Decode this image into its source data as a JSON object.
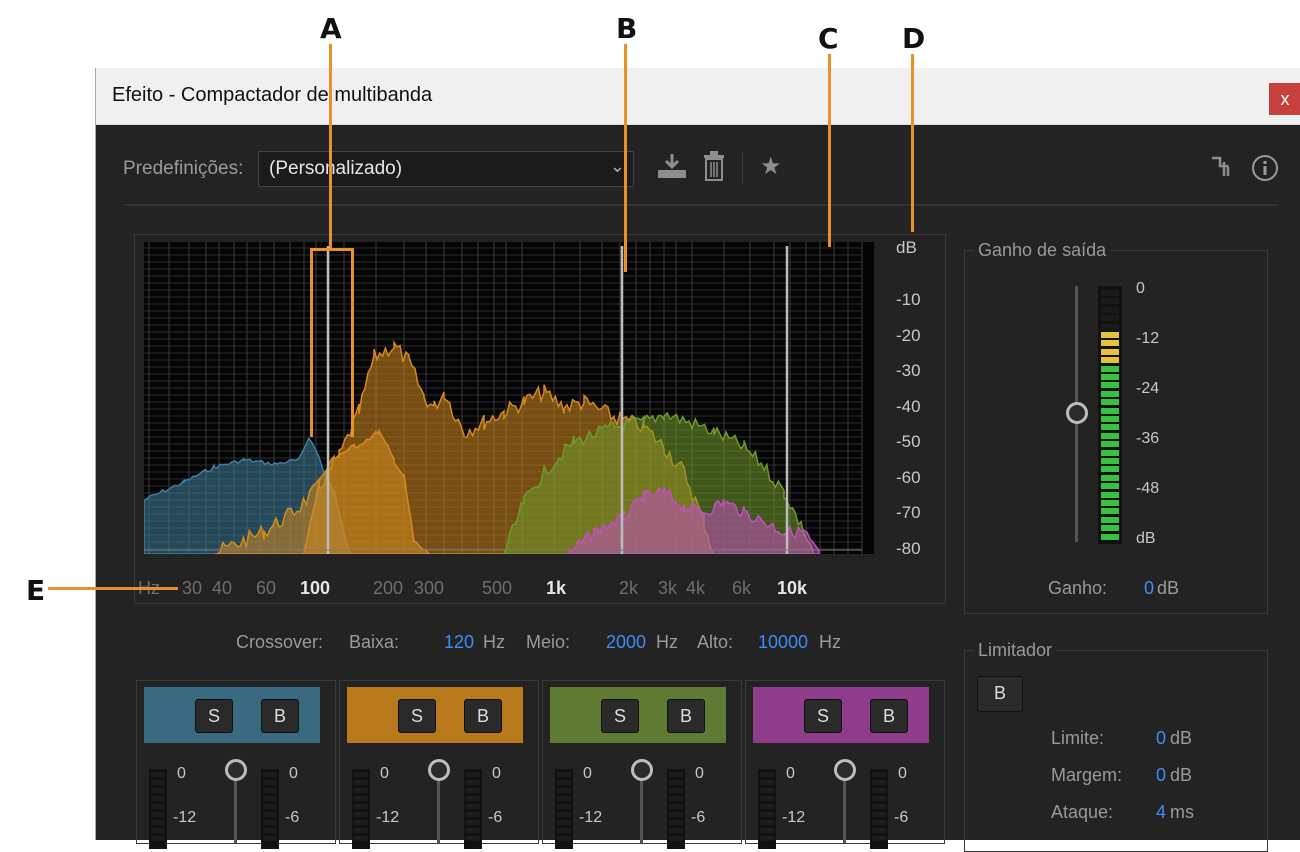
{
  "callouts": [
    "A",
    "B",
    "C",
    "D",
    "E"
  ],
  "window": {
    "title": "Efeito - Compactador de multibanda",
    "close": "x"
  },
  "presets": {
    "label": "Predefinições:",
    "value": "(Personalizado)"
  },
  "toolbar": {
    "save_icon": "download-icon",
    "delete_icon": "trash-icon",
    "favorite_icon": "star-icon",
    "routing_icon": "routing-icon",
    "info_icon": "info-icon"
  },
  "graph": {
    "db_label": "dB",
    "db_ticks": [
      "-10",
      "-20",
      "-30",
      "-40",
      "-50",
      "-60",
      "-70",
      "-80"
    ],
    "freq_ticks": [
      {
        "label": "Hz",
        "bold": false,
        "bright": false
      },
      {
        "label": "30",
        "bold": false,
        "bright": false
      },
      {
        "label": "40",
        "bold": false,
        "bright": false
      },
      {
        "label": "60",
        "bold": false,
        "bright": false
      },
      {
        "label": "100",
        "bold": true,
        "bright": true
      },
      {
        "label": "200",
        "bold": false,
        "bright": false
      },
      {
        "label": "300",
        "bold": false,
        "bright": false
      },
      {
        "label": "500",
        "bold": false,
        "bright": false
      },
      {
        "label": "1k",
        "bold": true,
        "bright": true
      },
      {
        "label": "2k",
        "bold": false,
        "bright": false
      },
      {
        "label": "3k",
        "bold": false,
        "bright": false
      },
      {
        "label": "4k",
        "bold": false,
        "bright": false
      },
      {
        "label": "6k",
        "bold": false,
        "bright": false
      },
      {
        "label": "10k",
        "bold": true,
        "bright": true
      }
    ],
    "band_colors": [
      "#3f7f9c",
      "#d48a1f",
      "#6f9a2a",
      "#c24fc0"
    ]
  },
  "crossover": {
    "label": "Crossover:",
    "low_label": "Baixa:",
    "low_value": "120",
    "low_unit": "Hz",
    "mid_label": "Meio:",
    "mid_value": "2000",
    "mid_unit": "Hz",
    "high_label": "Alto:",
    "high_value": "10000",
    "high_unit": "Hz"
  },
  "output": {
    "title": "Ganho de saída",
    "scale": [
      "0",
      "-12",
      "-24",
      "-36",
      "-48",
      "dB"
    ],
    "gain_label": "Ganho:",
    "gain_value": "0",
    "gain_unit": "dB"
  },
  "limiter": {
    "title": "Limitador",
    "bypass": "B",
    "rows": [
      {
        "label": "Limite:",
        "value": "0",
        "unit": "dB"
      },
      {
        "label": "Margem:",
        "value": "0",
        "unit": "dB"
      },
      {
        "label": "Ataque:",
        "value": "4",
        "unit": "ms"
      }
    ]
  },
  "bands": [
    {
      "color": "#3a6a80",
      "solo": "S",
      "bypass": "B",
      "left_ticks": [
        "0",
        "-12"
      ],
      "right_ticks": [
        "0",
        "-6"
      ]
    },
    {
      "color": "#b8791c",
      "solo": "S",
      "bypass": "B",
      "left_ticks": [
        "0",
        "-12"
      ],
      "right_ticks": [
        "0",
        "-6"
      ]
    },
    {
      "color": "#5e7a33",
      "solo": "S",
      "bypass": "B",
      "left_ticks": [
        "0",
        "-12"
      ],
      "right_ticks": [
        "0",
        "-6"
      ]
    },
    {
      "color": "#8f3c8c",
      "solo": "S",
      "bypass": "B",
      "left_ticks": [
        "0",
        "-12"
      ],
      "right_ticks": [
        "0",
        "-6"
      ]
    }
  ]
}
